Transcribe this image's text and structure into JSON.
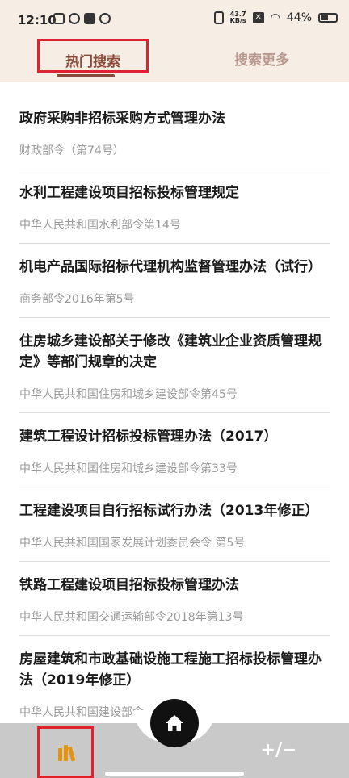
{
  "status_bar": {
    "time": "12:10",
    "net_speed_value": "43.7",
    "net_speed_unit": "KB/s",
    "battery": "44%"
  },
  "tabs": {
    "hot": "热门搜索",
    "more": "搜索更多"
  },
  "list": [
    {
      "title": "政府采购非招标采购方式管理办法",
      "source": "财政部令（第74号）"
    },
    {
      "title": "水利工程建设项目招标投标管理规定",
      "source": "中华人民共和国水利部令第14号"
    },
    {
      "title": "机电产品国际招标代理机构监督管理办法（试行）",
      "source": "商务部令2016年第5号"
    },
    {
      "title": "住房城乡建设部关于修改《建筑业企业资质管理规定》等部门规章的决定",
      "source": "中华人民共和国住房和城乡建设部令第45号"
    },
    {
      "title": "建筑工程设计招标投标管理办法（2017）",
      "source": "中华人民共和国住房和城乡建设部令第33号"
    },
    {
      "title": "工程建设项目自行招标试行办法（2013年修正）",
      "source": "中华人民共和国国家发展计划委员会令 第5号"
    },
    {
      "title": "铁路工程建设项目招标投标管理办法",
      "source": "中华人民共和国交通运输部令2018年第13号"
    },
    {
      "title": "房屋建筑和市政基础设施工程施工招标投标管理办法（2019年修正）",
      "source": "中华人民共和国建设部令"
    }
  ],
  "bottom_nav": {
    "left_icon": "books-icon",
    "center_icon": "home-icon",
    "right_icon": "plus-minus-icon",
    "calc_glyph": "+∕−"
  },
  "colors": {
    "header_bg": "#f6ede4",
    "active_tab": "#8a4a3a",
    "inactive_tab": "#b8988e",
    "highlight": "#e0212f",
    "book_accent": "#e39412"
  }
}
